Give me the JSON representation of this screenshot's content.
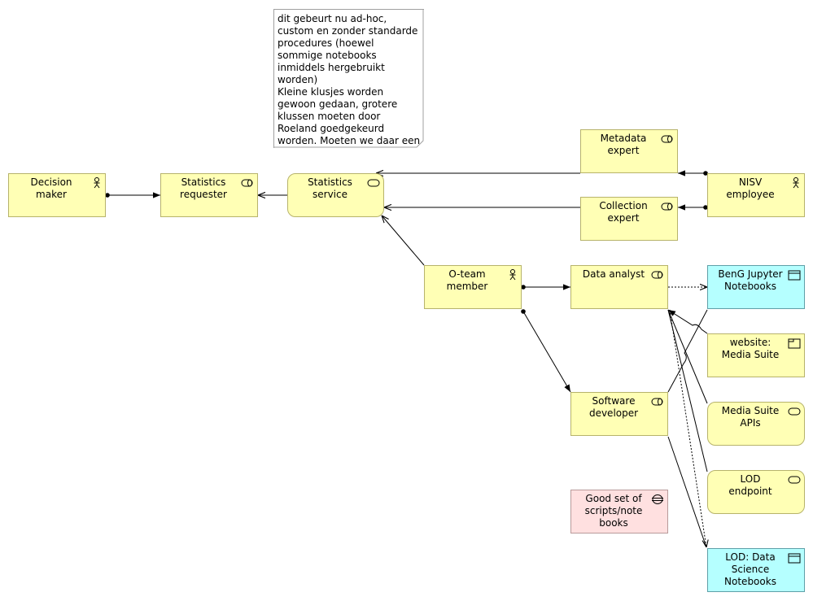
{
  "diagram": {
    "note": {
      "text": "dit gebeurt nu ad-hoc,\ncustom en zonder standarde\nprocedures (hoewel\nsommige notebooks\ninmiddels hergebruikt\nworden)\nKleine klusjes worden\ngewoon gedaan, grotere\nklussen moeten door\nRoeland goedgekeurd\nworden. Moeten we daar een"
    },
    "elements": {
      "decision_maker": {
        "label": "Decision\nmaker",
        "type": "business-actor"
      },
      "statistics_requester": {
        "label": "Statistics\nrequester",
        "type": "business-role"
      },
      "statistics_service": {
        "label": "Statistics\nservice",
        "type": "business-service"
      },
      "metadata_expert": {
        "label": "Metadata\nexpert",
        "type": "business-role"
      },
      "collection_expert": {
        "label": "Collection\nexpert",
        "type": "business-role"
      },
      "nisv_employee": {
        "label": "NISV\nemployee",
        "type": "business-actor"
      },
      "oteam_member": {
        "label": "O-team\nmember",
        "type": "business-actor"
      },
      "data_analyst": {
        "label": "Data analyst",
        "type": "business-role"
      },
      "beng_jupyter": {
        "label": "BenG Jupyter\nNotebooks",
        "type": "application-component"
      },
      "website_media_suite": {
        "label": "website:\nMedia Suite",
        "type": "business-object"
      },
      "software_developer": {
        "label": "Software\ndeveloper",
        "type": "business-role"
      },
      "media_suite_apis": {
        "label": "Media Suite\nAPIs",
        "type": "business-service"
      },
      "lod_endpoint": {
        "label": "LOD\nendpoint",
        "type": "business-service"
      },
      "good_set_scripts": {
        "label": "Good set of\nscripts/note\nbooks",
        "type": "goal"
      },
      "lod_notebooks": {
        "label": "LOD: Data\nScience\nNotebooks",
        "type": "application-component"
      }
    },
    "colors": {
      "business": "#ffffb5",
      "application": "#b5ffff",
      "motivation": "#ffe0e0",
      "line": "#000000"
    }
  }
}
